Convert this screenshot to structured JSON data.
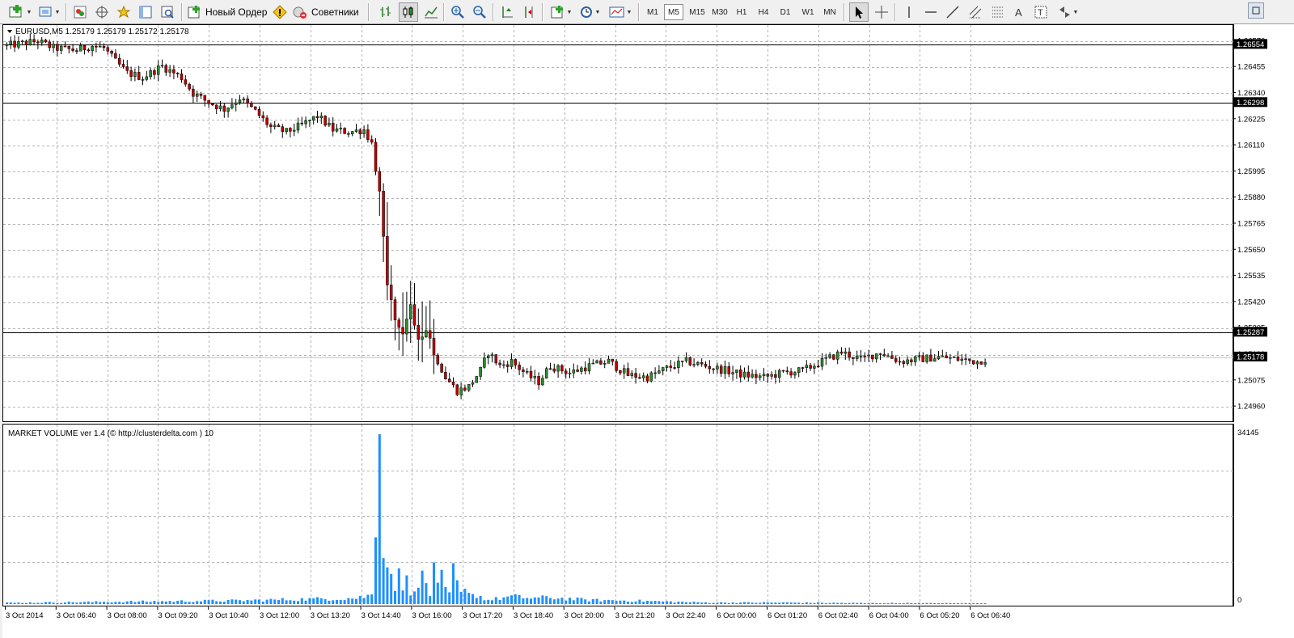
{
  "toolbar": {
    "new_order_label": "Новый Ордер",
    "advisors_label": "Советники",
    "timeframes": [
      "M1",
      "M5",
      "M15",
      "M30",
      "H1",
      "H4",
      "D1",
      "W1",
      "MN"
    ],
    "active_timeframe": "M5",
    "icons": [
      "new-chart-icon",
      "profiles-icon",
      "market-watch-icon",
      "navigator-icon",
      "favorites-icon",
      "data-window-icon",
      "tester-icon",
      "new-order-icon",
      "alert-icon",
      "advisors-icon",
      "bar-chart-icon",
      "candle-chart-icon",
      "line-chart-icon",
      "zoom-in-icon",
      "zoom-out-icon",
      "autoscroll-icon",
      "chart-shift-icon",
      "indicators-icon",
      "periods-icon",
      "templates-icon",
      "cursor-icon",
      "crosshair-icon",
      "vertical-line-icon",
      "horizontal-line-icon",
      "trendline-icon",
      "channel-icon",
      "fibonacci-icon",
      "text-icon",
      "label-icon",
      "shapes-icon"
    ]
  },
  "chart": {
    "symbol_info": "EURUSD,M5  1.25179 1.25179 1.25172 1.25178",
    "indicator_label": "MARKET VOLUME ver 1.4 (© http://clusterdelta.com ) 10",
    "colors": {
      "bull_candle": "#2e8b2e",
      "bear_candle": "#c00000",
      "volume_bar": "#1e90ff",
      "grid": "#b4b4b4",
      "price_tag_bg": "#000000",
      "price_tag_text": "#ffffff"
    }
  },
  "chart_data": [
    {
      "type": "candlestick",
      "title": "EURUSD,M5",
      "ylim": [
        1.249,
        1.2663
      ],
      "y_ticks": [
        "1.26570",
        "1.26455",
        "1.26340",
        "1.26225",
        "1.26110",
        "1.25995",
        "1.25880",
        "1.25765",
        "1.25650",
        "1.25535",
        "1.25420",
        "1.25305",
        "1.25190",
        "1.25075",
        "1.24960"
      ],
      "horizontal_lines": [
        1.26554,
        1.26298,
        1.25287
      ],
      "price_tags": [
        "1.26554",
        "1.26298",
        "1.25287",
        "1.25178"
      ],
      "last_price": 1.25178,
      "x_labels": [
        "3 Oct 2014",
        "3 Oct 06:40",
        "3 Oct 08:00",
        "3 Oct 09:20",
        "3 Oct 10:40",
        "3 Oct 12:00",
        "3 Oct 13:20",
        "3 Oct 14:40",
        "3 Oct 16:00",
        "3 Oct 17:20",
        "3 Oct 18:40",
        "3 Oct 20:00",
        "3 Oct 21:20",
        "3 Oct 22:40",
        "6 Oct 00:00",
        "6 Oct 01:20",
        "6 Oct 02:40",
        "6 Oct 04:00",
        "6 Oct 05:20",
        "6 Oct 06:40"
      ],
      "grid": true,
      "close_path": [
        [
          0,
          1.2655
        ],
        [
          8,
          1.2657
        ],
        [
          12,
          1.2654
        ],
        [
          18,
          1.2653
        ],
        [
          22,
          1.2655
        ],
        [
          25,
          1.2654
        ],
        [
          28,
          1.2648
        ],
        [
          31,
          1.2643
        ],
        [
          35,
          1.2641
        ],
        [
          40,
          1.2646
        ],
        [
          45,
          1.2641
        ],
        [
          48,
          1.2634
        ],
        [
          52,
          1.263
        ],
        [
          56,
          1.2627
        ],
        [
          60,
          1.2632
        ],
        [
          64,
          1.2626
        ],
        [
          68,
          1.2619
        ],
        [
          72,
          1.2617
        ],
        [
          76,
          1.262
        ],
        [
          80,
          1.2624
        ],
        [
          84,
          1.2618
        ],
        [
          88,
          1.2617
        ],
        [
          92,
          1.2618
        ],
        [
          94,
          1.2612
        ],
        [
          96,
          1.259
        ],
        [
          98,
          1.255
        ],
        [
          100,
          1.2535
        ],
        [
          102,
          1.2527
        ],
        [
          104,
          1.254
        ],
        [
          106,
          1.2524
        ],
        [
          108,
          1.253
        ],
        [
          110,
          1.252
        ],
        [
          113,
          1.2509
        ],
        [
          116,
          1.2503
        ],
        [
          119,
          1.2505
        ],
        [
          122,
          1.2512
        ],
        [
          124,
          1.252
        ],
        [
          127,
          1.2514
        ],
        [
          130,
          1.2516
        ],
        [
          134,
          1.251
        ],
        [
          137,
          1.2507
        ],
        [
          140,
          1.2514
        ],
        [
          145,
          1.2511
        ],
        [
          150,
          1.2514
        ],
        [
          155,
          1.2516
        ],
        [
          160,
          1.251
        ],
        [
          165,
          1.2509
        ],
        [
          170,
          1.2513
        ],
        [
          175,
          1.2516
        ],
        [
          180,
          1.2514
        ],
        [
          185,
          1.2512
        ],
        [
          190,
          1.251
        ],
        [
          195,
          1.2509
        ],
        [
          200,
          1.2511
        ],
        [
          205,
          1.2512
        ],
        [
          210,
          1.2516
        ],
        [
          215,
          1.252
        ],
        [
          220,
          1.2517
        ],
        [
          225,
          1.252
        ],
        [
          230,
          1.2516
        ],
        [
          235,
          1.2517
        ],
        [
          240,
          1.2518
        ],
        [
          245,
          1.2517
        ],
        [
          250,
          1.2516
        ],
        [
          252,
          1.2517
        ]
      ]
    },
    {
      "type": "bar",
      "title": "MARKET VOLUME ver 1.4",
      "ylim": [
        0,
        34145
      ],
      "y_ticks": [
        "34145",
        "0"
      ],
      "spike_path": [
        [
          0,
          250
        ],
        [
          60,
          700
        ],
        [
          90,
          1200
        ],
        [
          94,
          1800
        ],
        [
          96,
          34145
        ],
        [
          97,
          14000
        ],
        [
          98,
          9000
        ],
        [
          99,
          6000
        ],
        [
          100,
          4000
        ],
        [
          101,
          5500
        ],
        [
          102,
          3500
        ],
        [
          103,
          4500
        ],
        [
          104,
          2800
        ],
        [
          105,
          4000
        ],
        [
          106,
          2500
        ],
        [
          107,
          6000
        ],
        [
          108,
          4500
        ],
        [
          109,
          2000
        ],
        [
          110,
          6000
        ],
        [
          111,
          3500
        ],
        [
          112,
          5000
        ],
        [
          113,
          2500
        ],
        [
          114,
          2200
        ],
        [
          115,
          6200
        ],
        [
          116,
          4000
        ],
        [
          117,
          2000
        ],
        [
          118,
          2500
        ],
        [
          119,
          3500
        ],
        [
          120,
          2000
        ],
        [
          121,
          1500
        ],
        [
          122,
          1500
        ],
        [
          124,
          800
        ],
        [
          130,
          1500
        ],
        [
          135,
          1200
        ],
        [
          140,
          1300
        ],
        [
          150,
          800
        ],
        [
          160,
          700
        ],
        [
          170,
          500
        ],
        [
          180,
          300
        ],
        [
          200,
          300
        ],
        [
          220,
          200
        ],
        [
          252,
          150
        ]
      ]
    }
  ]
}
